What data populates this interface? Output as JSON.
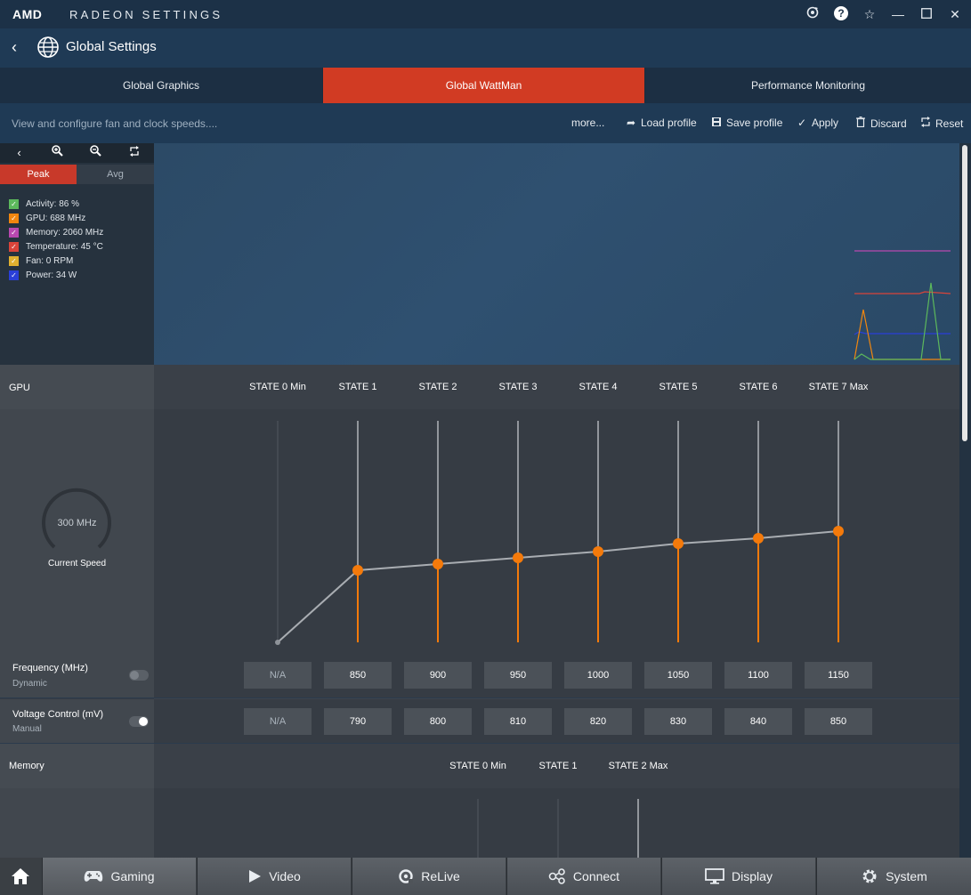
{
  "window": {
    "logo": "AMD",
    "app_name": "RADEON SETTINGS",
    "buttons": [
      "refresh-icon",
      "help-icon",
      "star-icon",
      "minimize-icon",
      "maximize-icon",
      "close-icon"
    ]
  },
  "header": {
    "title": "Global Settings"
  },
  "tabs": [
    {
      "label": "Global Graphics",
      "active": false
    },
    {
      "label": "Global WattMan",
      "active": true
    },
    {
      "label": "Performance Monitoring",
      "active": false
    }
  ],
  "actionbar": {
    "description": "View and configure fan and clock speeds....",
    "more": "more...",
    "load": "Load profile",
    "save": "Save profile",
    "apply": "Apply",
    "discard": "Discard",
    "reset": "Reset"
  },
  "monitor": {
    "peak_label": "Peak",
    "avg_label": "Avg",
    "legend": [
      {
        "label": "Activity: 86 %",
        "color": "#5cb85c"
      },
      {
        "label": "GPU: 688 MHz",
        "color": "#f0860f"
      },
      {
        "label": "Memory: 2060 MHz",
        "color": "#b848b0"
      },
      {
        "label": "Temperature: 45 °C",
        "color": "#d9443a"
      },
      {
        "label": "Fan: 0 RPM",
        "color": "#e0b030"
      },
      {
        "label": "Power: 34 W",
        "color": "#2a3fd8"
      }
    ]
  },
  "gpu": {
    "section_label": "GPU",
    "states": [
      "STATE 0 Min",
      "STATE 1",
      "STATE 2",
      "STATE 3",
      "STATE 4",
      "STATE 5",
      "STATE 6",
      "STATE 7 Max"
    ],
    "current_speed_value": "300 MHz",
    "current_speed_label": "Current Speed",
    "frequency": {
      "title": "Frequency (MHz)",
      "mode": "Dynamic",
      "values": [
        "N/A",
        "850",
        "900",
        "950",
        "1000",
        "1050",
        "1100",
        "1150"
      ]
    },
    "voltage": {
      "title": "Voltage Control (mV)",
      "mode": "Manual",
      "values": [
        "N/A",
        "790",
        "800",
        "810",
        "820",
        "830",
        "840",
        "850"
      ]
    },
    "accent_color": "#f47a0b"
  },
  "memory": {
    "section_label": "Memory",
    "states": [
      "STATE 0 Min",
      "STATE 1",
      "STATE 2 Max"
    ]
  },
  "bottomnav": [
    {
      "label": "Gaming",
      "icon": "gamepad-icon",
      "active": true
    },
    {
      "label": "Video",
      "icon": "play-icon",
      "active": false
    },
    {
      "label": "ReLive",
      "icon": "relive-icon",
      "active": false
    },
    {
      "label": "Connect",
      "icon": "connect-icon",
      "active": false
    },
    {
      "label": "Display",
      "icon": "monitor-icon",
      "active": false
    },
    {
      "label": "System",
      "icon": "gear-icon",
      "active": false
    }
  ]
}
